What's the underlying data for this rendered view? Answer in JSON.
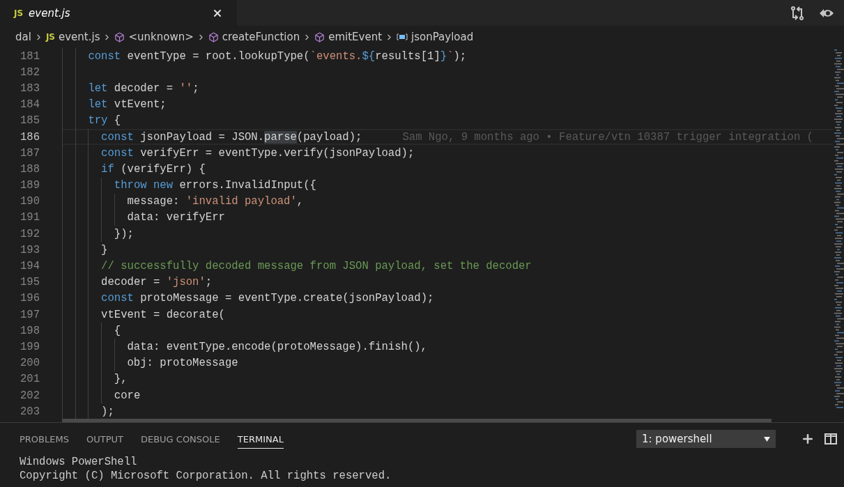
{
  "tabs": [
    {
      "badge": "JS",
      "label": "event.js",
      "selected": true
    }
  ],
  "breadcrumb": [
    {
      "kind": "folder",
      "label": "dal"
    },
    {
      "kind": "file",
      "badge": "JS",
      "label": "event.js"
    },
    {
      "kind": "module",
      "label": "<unknown>"
    },
    {
      "kind": "module",
      "label": "createFunction"
    },
    {
      "kind": "module",
      "label": "emitEvent"
    },
    {
      "kind": "variable",
      "label": "jsonPayload"
    }
  ],
  "editor": {
    "lines": [
      {
        "number": "181",
        "current": false,
        "tokens": [
          {
            "kind": "keyword",
            "text": "const"
          },
          {
            "kind": "plain",
            "text": " eventType = root.lookupType("
          },
          {
            "kind": "string",
            "text": "`events."
          },
          {
            "kind": "keyword",
            "text": "${"
          },
          {
            "kind": "plain",
            "text": "results[1]"
          },
          {
            "kind": "keyword",
            "text": "}"
          },
          {
            "kind": "string",
            "text": "`"
          },
          {
            "kind": "plain",
            "text": ");"
          }
        ]
      },
      {
        "number": "182",
        "current": false
      },
      {
        "number": "183",
        "current": false,
        "tokens": [
          {
            "kind": "keyword",
            "text": "let"
          },
          {
            "kind": "plain",
            "text": " decoder = "
          },
          {
            "kind": "string",
            "text": "''"
          },
          {
            "kind": "plain",
            "text": ";"
          }
        ]
      },
      {
        "number": "184",
        "current": false,
        "tokens": [
          {
            "kind": "keyword",
            "text": "let"
          },
          {
            "kind": "plain",
            "text": " vtEvent;"
          }
        ]
      },
      {
        "number": "185",
        "current": false,
        "tokens": [
          {
            "kind": "keyword",
            "text": "try"
          },
          {
            "kind": "plain",
            "text": " {"
          }
        ],
        "children": [
          {
            "number": "186",
            "current": true,
            "blame": "Sam Ngo, 9 months ago • Feature/vtn 10387 trigger integration (",
            "tokens": [
              {
                "kind": "keyword",
                "text": "const"
              },
              {
                "kind": "plain",
                "text": " jsonPayload = JSON."
              },
              {
                "kind": "highlight",
                "text": "parse"
              },
              {
                "kind": "plain",
                "text": "(payload);"
              }
            ]
          },
          {
            "number": "187",
            "current": false,
            "tokens": [
              {
                "kind": "keyword",
                "text": "const"
              },
              {
                "kind": "plain",
                "text": " verifyErr = eventType.verify(jsonPayload);"
              }
            ]
          },
          {
            "number": "188",
            "current": false,
            "tokens": [
              {
                "kind": "keyword",
                "text": "if"
              },
              {
                "kind": "plain",
                "text": " (verifyErr) {"
              }
            ],
            "children": [
              {
                "number": "189",
                "current": false,
                "tokens": [
                  {
                    "kind": "keyword",
                    "text": "throw new"
                  },
                  {
                    "kind": "plain",
                    "text": " errors.InvalidInput({"
                  }
                ],
                "children": [
                  {
                    "number": "190",
                    "current": false,
                    "tokens": [
                      {
                        "kind": "plain",
                        "text": "message: "
                      },
                      {
                        "kind": "string",
                        "text": "'invalid payload'"
                      },
                      {
                        "kind": "plain",
                        "text": ","
                      }
                    ]
                  },
                  {
                    "number": "191",
                    "current": false,
                    "tokens": [
                      {
                        "kind": "plain",
                        "text": "data: verifyErr"
                      }
                    ]
                  }
                ]
              },
              {
                "number": "192",
                "current": false,
                "tokens": [
                  {
                    "kind": "plain",
                    "text": "});"
                  }
                ]
              }
            ]
          },
          {
            "number": "193",
            "current": false,
            "tokens": [
              {
                "kind": "plain",
                "text": "}"
              }
            ]
          },
          {
            "number": "194",
            "current": false,
            "tokens": [
              {
                "kind": "comment",
                "text": "// successfully decoded message from JSON payload, set the decoder"
              }
            ]
          },
          {
            "number": "195",
            "current": false,
            "tokens": [
              {
                "kind": "plain",
                "text": "decoder = "
              },
              {
                "kind": "string",
                "text": "'json'"
              },
              {
                "kind": "plain",
                "text": ";"
              }
            ]
          },
          {
            "number": "196",
            "current": false,
            "tokens": [
              {
                "kind": "keyword",
                "text": "const"
              },
              {
                "kind": "plain",
                "text": " protoMessage = eventType.create(jsonPayload);"
              }
            ]
          },
          {
            "number": "197",
            "current": false,
            "tokens": [
              {
                "kind": "plain",
                "text": "vtEvent = decorate("
              }
            ],
            "children": [
              {
                "number": "198",
                "current": false,
                "tokens": [
                  {
                    "kind": "plain",
                    "text": "{"
                  }
                ],
                "children": [
                  {
                    "number": "199",
                    "current": false,
                    "tokens": [
                      {
                        "kind": "plain",
                        "text": "data: eventType.encode(protoMessage).finish(),"
                      }
                    ]
                  },
                  {
                    "number": "200",
                    "current": false,
                    "tokens": [
                      {
                        "kind": "plain",
                        "text": "obj: protoMessage"
                      }
                    ]
                  }
                ]
              },
              {
                "number": "201",
                "current": false,
                "tokens": [
                  {
                    "kind": "plain",
                    "text": "},"
                  }
                ]
              },
              {
                "number": "202",
                "current": false,
                "tokens": [
                  {
                    "kind": "plain",
                    "text": "core"
                  }
                ]
              }
            ]
          },
          {
            "number": "203",
            "current": false,
            "tokens": [
              {
                "kind": "plain",
                "text": ");"
              }
            ]
          }
        ]
      }
    ]
  },
  "panel": {
    "tabs": [
      {
        "label": "PROBLEMS",
        "selected": false
      },
      {
        "label": "OUTPUT",
        "selected": false
      },
      {
        "label": "DEBUG CONSOLE",
        "selected": false
      },
      {
        "label": "TERMINAL",
        "selected": true
      }
    ],
    "terminal_select": "1: powershell",
    "terminal_lines": [
      "Windows PowerShell",
      "Copyright (C) Microsoft Corporation. All rights reserved."
    ]
  }
}
